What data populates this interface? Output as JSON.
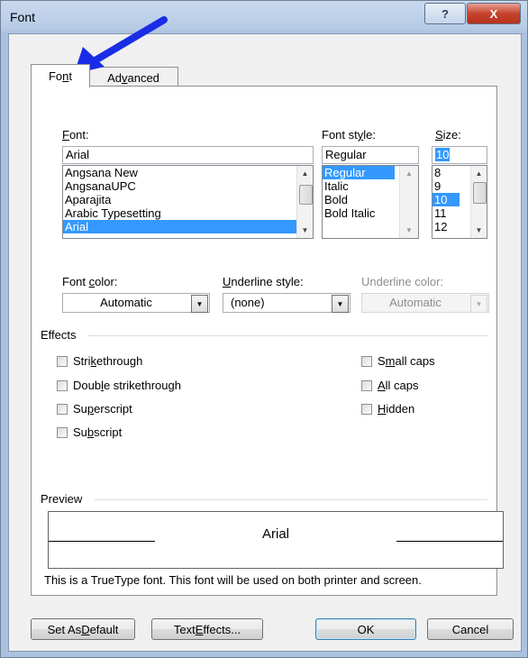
{
  "window": {
    "title": "Font",
    "help_label": "?",
    "close_label": "X"
  },
  "tabs": [
    {
      "label_pre": "Fo",
      "label_ul": "n",
      "label_post": "t",
      "active": true
    },
    {
      "label_pre": "Ad",
      "label_ul": "v",
      "label_post": "anced",
      "active": false
    }
  ],
  "font": {
    "label_ul": "F",
    "label_post": "ont:",
    "value": "Arial",
    "options": [
      "Angsana New",
      "AngsanaUPC",
      "Aparajita",
      "Arabic Typesetting",
      "Arial"
    ],
    "selected_index": 4
  },
  "font_style": {
    "label_pre": "Font st",
    "label_ul": "y",
    "label_post": "le:",
    "value": "Regular",
    "options": [
      "Regular",
      "Italic",
      "Bold",
      "Bold Italic"
    ],
    "selected_index": 0
  },
  "size": {
    "label_ul": "S",
    "label_post": "ize:",
    "value": "10",
    "options": [
      "8",
      "9",
      "10",
      "11",
      "12"
    ],
    "selected_index": 2
  },
  "font_color": {
    "label_pre": "Font ",
    "label_ul": "c",
    "label_post": "olor:",
    "value": "Automatic"
  },
  "underline_style": {
    "label_ul": "U",
    "label_post": "nderline style:",
    "value": "(none)"
  },
  "underline_color": {
    "label": "Underline color:",
    "value": "Automatic"
  },
  "effects": {
    "title": "Effects",
    "left": [
      {
        "pre": "Stri",
        "ul": "k",
        "post": "ethrough"
      },
      {
        "pre": "Doub",
        "ul": "l",
        "post": "e strikethrough"
      },
      {
        "pre": "Su",
        "ul": "p",
        "post": "erscript"
      },
      {
        "pre": "Su",
        "ul": "b",
        "post": "script"
      }
    ],
    "right": [
      {
        "pre": "S",
        "ul": "m",
        "post": "all caps"
      },
      {
        "pre": "",
        "ul": "A",
        "post": "ll caps"
      },
      {
        "pre": "",
        "ul": "H",
        "post": "idden"
      }
    ]
  },
  "preview": {
    "title": "Preview",
    "sample": "Arial",
    "description": "This is a TrueType font. This font will be used on both printer and screen."
  },
  "buttons": {
    "set_default": {
      "pre": "Set As ",
      "ul": "D",
      "post": "efault"
    },
    "text_effects": {
      "pre": "Text ",
      "ul": "E",
      "post": "ffects..."
    },
    "ok": "OK",
    "cancel": "Cancel"
  },
  "colors": {
    "selection": "#3399ff",
    "annotation_arrow": "#1a2de6"
  }
}
